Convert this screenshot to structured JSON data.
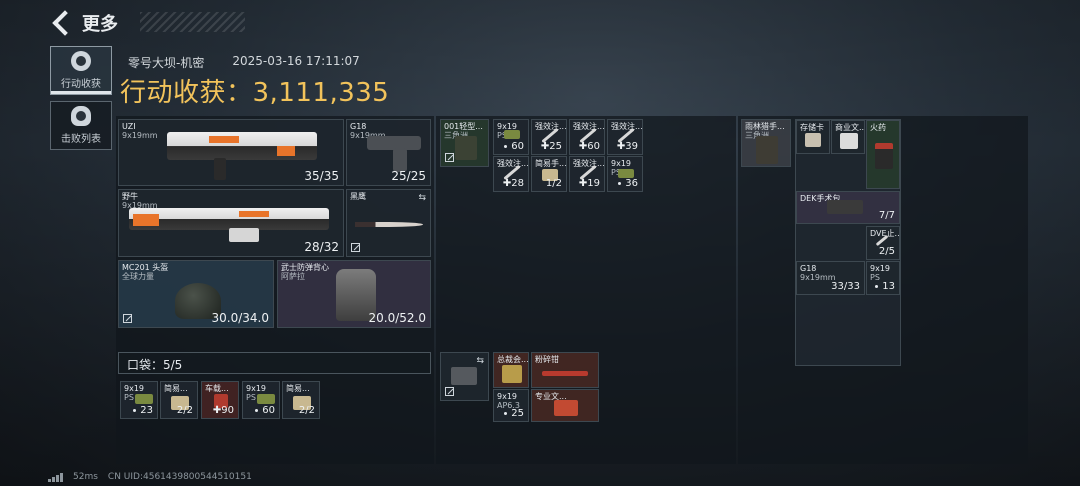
{
  "header": {
    "title": "更多"
  },
  "tabs": [
    {
      "label": "行动收获",
      "active": true
    },
    {
      "label": "击败列表",
      "active": false
    }
  ],
  "info": {
    "map": "零号大坝-机密",
    "datetime": "2025-03-16 17:11:07",
    "harvest_label": "行动收获：",
    "harvest_value": "3,111,335"
  },
  "equipment": {
    "primary": {
      "name": "UZI",
      "caliber": "9x19mm",
      "ammo": "35/35"
    },
    "secondary": {
      "name": "G18",
      "caliber": "9x19mm",
      "ammo": "25/25"
    },
    "primary2": {
      "name": "野牛",
      "caliber": "9x19mm",
      "ammo": "28/32"
    },
    "melee": {
      "name": "黑鹰"
    },
    "helmet": {
      "name": "MC201 头盔",
      "sub": "全球力量",
      "durability": "30.0/34.0"
    },
    "armor": {
      "name": "武士防弹背心",
      "sub": "阿萨拉",
      "durability": "20.0/52.0"
    }
  },
  "pocket": {
    "label": "口袋：5/5",
    "items": [
      {
        "name": "9x19",
        "sub": "PS",
        "count": "23",
        "kind": "ammo"
      },
      {
        "name": "简易...",
        "count": "2/2",
        "kind": "bag"
      },
      {
        "name": "车载...",
        "count": "90",
        "kind": "med"
      },
      {
        "name": "9x19",
        "sub": "PS",
        "count": "60",
        "kind": "ammo"
      },
      {
        "name": "简易...",
        "count": "2/2",
        "kind": "bag"
      }
    ]
  },
  "rig": {
    "items": [
      {
        "name": "001轻型...",
        "sub": "三角洲"
      },
      {
        "name": "9x19",
        "sub": "PS",
        "count": "60"
      },
      {
        "name": "强效注...",
        "count": "25"
      },
      {
        "name": "强效注...",
        "count": "60"
      },
      {
        "name": "强效注...",
        "count": "39"
      },
      {
        "name": "强效注...",
        "count": "28"
      },
      {
        "name": "简易手...",
        "count": "1/2"
      },
      {
        "name": "强效注...",
        "count": "19"
      },
      {
        "name": "9x19",
        "sub": "PS",
        "count": "36"
      }
    ]
  },
  "backpack_mid": {
    "items": [
      {
        "name": "总裁会..."
      },
      {
        "name": "粉碎钳"
      },
      {
        "name": "9x19",
        "sub": "AP6.3",
        "count": "25"
      },
      {
        "name": "专业文..."
      }
    ]
  },
  "bag": {
    "items": [
      {
        "name": "雨林猎手...",
        "sub": "三角洲"
      },
      {
        "name": "存储卡"
      },
      {
        "name": "商业文..."
      },
      {
        "name": "火药"
      },
      {
        "name": "DEK手术包",
        "count": "7/7"
      },
      {
        "name": "DVE止...",
        "count": "2/5"
      },
      {
        "name": "G18",
        "sub": "9x19mm",
        "count": "33/33"
      },
      {
        "name": "9x19",
        "sub": "PS",
        "count": "13"
      }
    ]
  },
  "footer": {
    "ping": "52ms",
    "uid": "CN UID:4561439800544510151"
  }
}
